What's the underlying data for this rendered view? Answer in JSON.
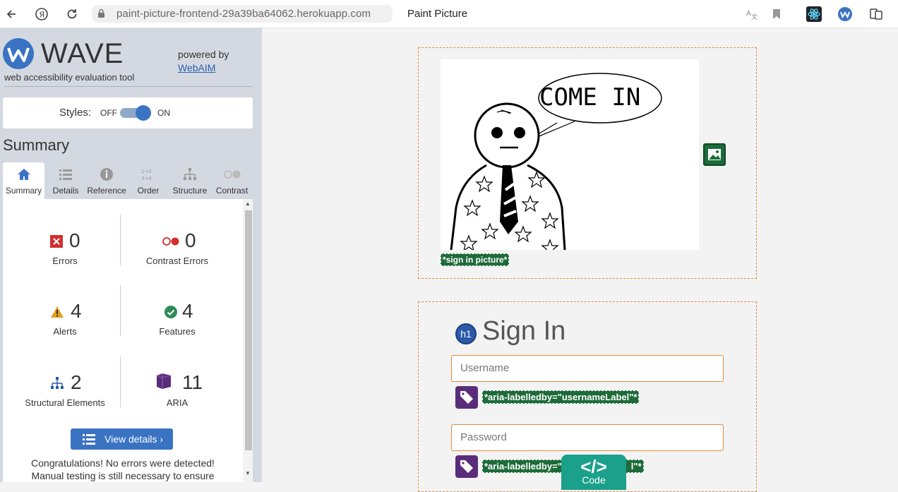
{
  "browser": {
    "url": "paint-picture-frontend-29a39ba64062.herokuapp.com",
    "tab_title": "Paint Picture"
  },
  "wave": {
    "title": "WAVE",
    "subtitle": "web accessibility evaluation tool",
    "powered_by": "powered by",
    "webaim_link": "WebAIM",
    "styles_label": "Styles:",
    "off": "OFF",
    "on": "ON",
    "summary_heading": "Summary",
    "tabs": [
      {
        "label": "Summary",
        "icon": "home-icon"
      },
      {
        "label": "Details",
        "icon": "list-icon"
      },
      {
        "label": "Reference",
        "icon": "info-icon"
      },
      {
        "label": "Order",
        "icon": "order-icon"
      },
      {
        "label": "Structure",
        "icon": "structure-icon"
      },
      {
        "label": "Contrast",
        "icon": "contrast-icon"
      }
    ],
    "stats": {
      "errors": {
        "count": "0",
        "label": "Errors"
      },
      "contrast_errors": {
        "count": "0",
        "label": "Contrast Errors"
      },
      "alerts": {
        "count": "4",
        "label": "Alerts"
      },
      "features": {
        "count": "4",
        "label": "Features"
      },
      "structural": {
        "count": "2",
        "label": "Structural Elements"
      },
      "aria": {
        "count": "11",
        "label": "ARIA"
      }
    },
    "view_details": "View details ›",
    "congrats_line1": "Congratulations! No errors were detected!",
    "congrats_line2": "Manual testing is still necessary to ensure"
  },
  "page": {
    "picture_text": "COME IN",
    "alt_tag": "*sign in picture*",
    "h1_badge": "h1",
    "heading": "Sign In",
    "username_placeholder": "Username",
    "username_aria": "*aria-labelledby=\"usernameLabel\"*",
    "password_placeholder": "Password",
    "password_aria": "*aria-labelledby=\"p",
    "password_aria_tail": "l\"*",
    "code_icon": "</>",
    "code_label": "Code"
  },
  "colors": {
    "wave_blue": "#3b73c3",
    "sidebar_bg": "#d4d9e1",
    "wave_tag_green": "#1e6b3a",
    "aria_purple": "#5a2d7a",
    "outline_orange": "#e08a3c",
    "code_teal": "#1aa08b"
  }
}
